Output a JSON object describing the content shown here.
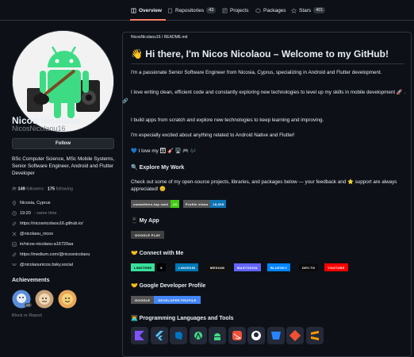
{
  "tabs": [
    {
      "label": "Overview",
      "icon": "book-icon"
    },
    {
      "label": "Repositories",
      "count": "43",
      "icon": "repo-icon"
    },
    {
      "label": "Projects",
      "icon": "project-icon"
    },
    {
      "label": "Packages",
      "icon": "package-icon"
    },
    {
      "label": "Stars",
      "count": "401",
      "icon": "star-icon"
    }
  ],
  "profile": {
    "name": "Nicos Nicolaou",
    "login": "NicosNicolaou16",
    "follow_label": "Follow",
    "bio": "BSc Computer Science, MSc Mobile Systems, Senior Software Engineer, Android and Flutter Developer",
    "followers": "149",
    "followers_label": "followers",
    "following": "175",
    "following_label": "following",
    "dot": "·",
    "location": "Nicosia, Cyprus",
    "time": "19:20",
    "time_note": "- same time",
    "website": "https://nicosnicolaou16.github.io/",
    "x_handle": "@nicolaou_nicos",
    "linkedin": "in/nicos-nicolaou-a16720aa",
    "medium": "https://medium.com/@nicosnicolaou",
    "bluesky": "@nicolaounicos.bsky.social",
    "achievements_title": "Achievements",
    "achievement_badge_count": "x2",
    "block_label": "Block or Report"
  },
  "readme": {
    "path": "NicosNicolaou16 / README.md",
    "title": "👋 Hi there, I'm Nicos Nicolaou – Welcome to my GitHub!",
    "p1": "I'm a passionate Senior Software Engineer from Nicosia, Cyprus, specializing in Android and Flutter development.",
    "p2": "I love writing clean, efficient code and constantly exploring new technologies to level up my skills in mobile development 🚀 .",
    "p3": "I build apps from scratch and explore new technologies to keep learning and improving.",
    "p4": "I'm especially excited about anything related to Android Native and Flutter!",
    "p5": "💙 I love my 👨‍👩‍👧 🎸 🖥️ 🎮 🎶",
    "explore_title": "🔍 Explore My Work",
    "p6": "Check out some of my open-source projects, libraries, and packages below — your feedback and ⭐ support are always appreciated! 😊",
    "rank_badge": {
      "left": "committers.top rank",
      "right": "#3"
    },
    "views_badge": {
      "left": "Profile views",
      "right": "18,069"
    },
    "app_title": "📱 My App",
    "gplay": "GOOGLE PLAY",
    "connect_title": "🤝 Connect with Me",
    "socials": [
      {
        "label": "LINKTREE",
        "color": "#39e09b",
        "text_color": "#000000"
      },
      {
        "label": "X",
        "color": "#000000",
        "text_color": "#ffffff"
      },
      {
        "label": "LINKEDIN",
        "color": "#0077b5",
        "text_color": "#ffffff"
      },
      {
        "label": "MEDIUM",
        "color": "#12100e",
        "text_color": "#ffffff"
      },
      {
        "label": "MASTODON",
        "color": "#6364ff",
        "text_color": "#ffffff"
      },
      {
        "label": "BLUESKY",
        "color": "#0285ff",
        "text_color": "#ffffff"
      },
      {
        "label": "DEV.TO",
        "color": "#0a0a0a",
        "text_color": "#ffffff"
      },
      {
        "label": "YOUTUBE",
        "color": "#ff0000",
        "text_color": "#ffffff"
      }
    ],
    "gdp_title": "🤝 Google Developer Profile",
    "gdp_left": "GOOGLE",
    "gdp_right": "DEVELOPER PROFILE",
    "lang_title": "👨‍💻 Programming Languages and Tools",
    "tools": [
      {
        "name": "kotlin-icon",
        "color": "#7f52ff"
      },
      {
        "name": "flutter-icon",
        "color": "#54c5f8"
      },
      {
        "name": "dart-icon",
        "color": "#0175c2"
      },
      {
        "name": "android-studio-icon",
        "color": "#3ddc84"
      },
      {
        "name": "android-icon",
        "color": "#3ddc84"
      },
      {
        "name": "swift-icon",
        "color": "#f05138"
      },
      {
        "name": "github-icon",
        "color": "#ffffff"
      },
      {
        "name": "bitbucket-icon",
        "color": "#2684ff"
      },
      {
        "name": "git-icon",
        "color": "#f05032"
      },
      {
        "name": "sublime-icon",
        "color": "#ff9800"
      }
    ]
  },
  "colors": {
    "accent": "#f78166",
    "link": "#4493f8",
    "muted": "#7d8590",
    "border": "#30363d"
  }
}
